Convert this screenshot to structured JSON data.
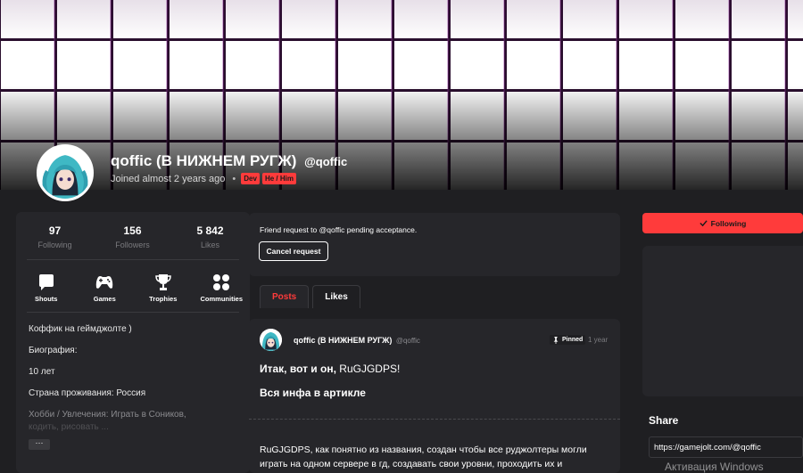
{
  "profile": {
    "display_name": "qoffic (В НИЖНЕМ РУГЖ)",
    "username": "@qoffic",
    "joined": "Joined almost 2 years ago",
    "dot": "•",
    "tags": [
      "Dev",
      "He / Him"
    ]
  },
  "stats": [
    {
      "value": "97",
      "label": "Following"
    },
    {
      "value": "156",
      "label": "Followers"
    },
    {
      "value": "5 842",
      "label": "Likes"
    }
  ],
  "nav": [
    {
      "label": "Shouts",
      "icon": "shouts-icon"
    },
    {
      "label": "Games",
      "icon": "gamepad-icon"
    },
    {
      "label": "Trophies",
      "icon": "trophy-icon"
    },
    {
      "label": "Communities",
      "icon": "communities-icon"
    }
  ],
  "bio": {
    "line1": "Коффик на геймджолте )",
    "line2": "Биография:",
    "line3": "10 лет",
    "line4": "Страна проживания: Россия",
    "line5": "Хобби / Увлечения: Играть в Соников,",
    "line6": "кодить, рисовать ...",
    "more_label": "···"
  },
  "friend_request": {
    "text": "Friend request to @qoffic pending acceptance.",
    "cancel_label": "Cancel request"
  },
  "tabs": [
    {
      "label": "Posts",
      "active": true
    },
    {
      "label": "Likes",
      "active": false
    }
  ],
  "post": {
    "author": "qoffic (В НИЖНЕМ РУГЖ)",
    "username": "@qoffic",
    "pinned_label": "Pinned",
    "time": "1 year",
    "heading_bold": "Итак, вот и он, ",
    "heading_normal": "RuGJGDPS!",
    "subheading": "Вся инфа в артикле",
    "body": "RuGJGDPS, как понятно из названия, создан чтобы все руджолтеры могли играть на одном сервере в гд, создавать свои уровни, проходить их и"
  },
  "right": {
    "following_label": "Following",
    "share_title": "Share",
    "share_url": "https://gamejolt.com/@qoffic",
    "watermark": "Активация Windows"
  },
  "colors": {
    "accent": "#ff3b3b",
    "background": "#1f1f22",
    "card": "#26262a"
  }
}
